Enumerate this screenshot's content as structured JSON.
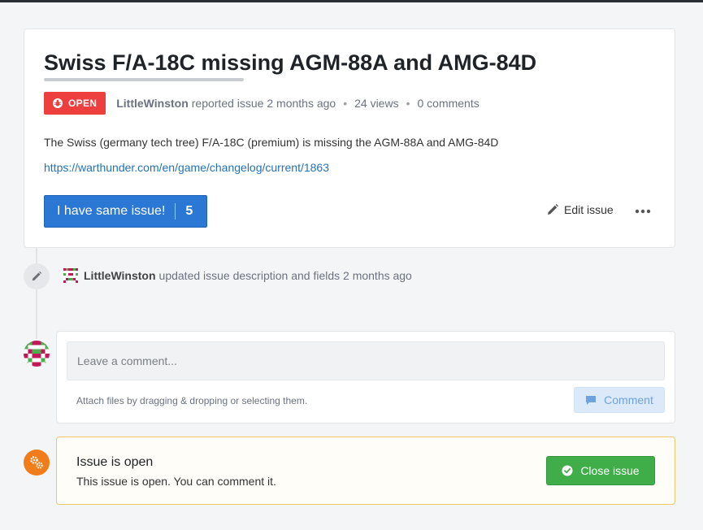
{
  "colors": {
    "accent": "#2b78d4",
    "open_badge": "#ee3f3f",
    "close_button": "#3fae49",
    "status_icon": "#f07d1a",
    "link": "#2472b8"
  },
  "issue": {
    "title": "Swiss F/A-18C missing AGM-88A and AMG-84D",
    "status_badge": "OPEN",
    "status_icon": "bug-icon",
    "author": "LittleWinston",
    "reported_text": "reported issue 2 months ago",
    "views": "24 views",
    "comments": "0 comments",
    "description": "The Swiss (germany tech tree) F/A-18C (premium) is missing the AGM-88A and AMG-84D",
    "link": "https://warthunder.com/en/game/changelog/current/1863",
    "same_issue_label": "I have same issue!",
    "same_issue_count": "5",
    "edit_label": "Edit issue",
    "edit_icon": "pencil-icon",
    "more_icon": "more-dots-icon"
  },
  "timeline": {
    "event_icon": "pencil-icon",
    "event_user": "LittleWinston",
    "event_text": "updated issue description and fields 2 months ago"
  },
  "comment": {
    "placeholder": "Leave a comment...",
    "attach_hint": "Attach files by dragging & dropping or selecting them.",
    "button_label": "Comment",
    "button_icon": "comment-icon"
  },
  "status_panel": {
    "icon": "gears-icon",
    "title": "Issue is open",
    "text": "This issue is open. You can comment it.",
    "close_label": "Close issue",
    "close_icon": "check-circle-icon"
  }
}
